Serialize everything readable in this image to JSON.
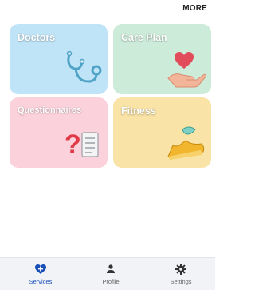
{
  "header": {
    "more_label": "MORE"
  },
  "tiles": [
    {
      "label": "Doctors",
      "color": "#bfe3f7",
      "icon": "stethoscope-icon"
    },
    {
      "label": "Care Plan",
      "color": "#cdebd9",
      "icon": "heart-hand-icon"
    },
    {
      "label": "Questionnaires",
      "color": "#fbd1dc",
      "icon": "question-clipboard-icon"
    },
    {
      "label": "Fitness",
      "color": "#f9e3a6",
      "icon": "running-shoe-icon"
    }
  ],
  "bottom_nav": {
    "active_color": "#1a4fb8",
    "items": [
      {
        "label": "Services",
        "icon": "heart-plus-icon",
        "active": true
      },
      {
        "label": "Profile",
        "icon": "person-icon",
        "active": false
      },
      {
        "label": "Settings",
        "icon": "gear-icon",
        "active": false
      }
    ]
  }
}
